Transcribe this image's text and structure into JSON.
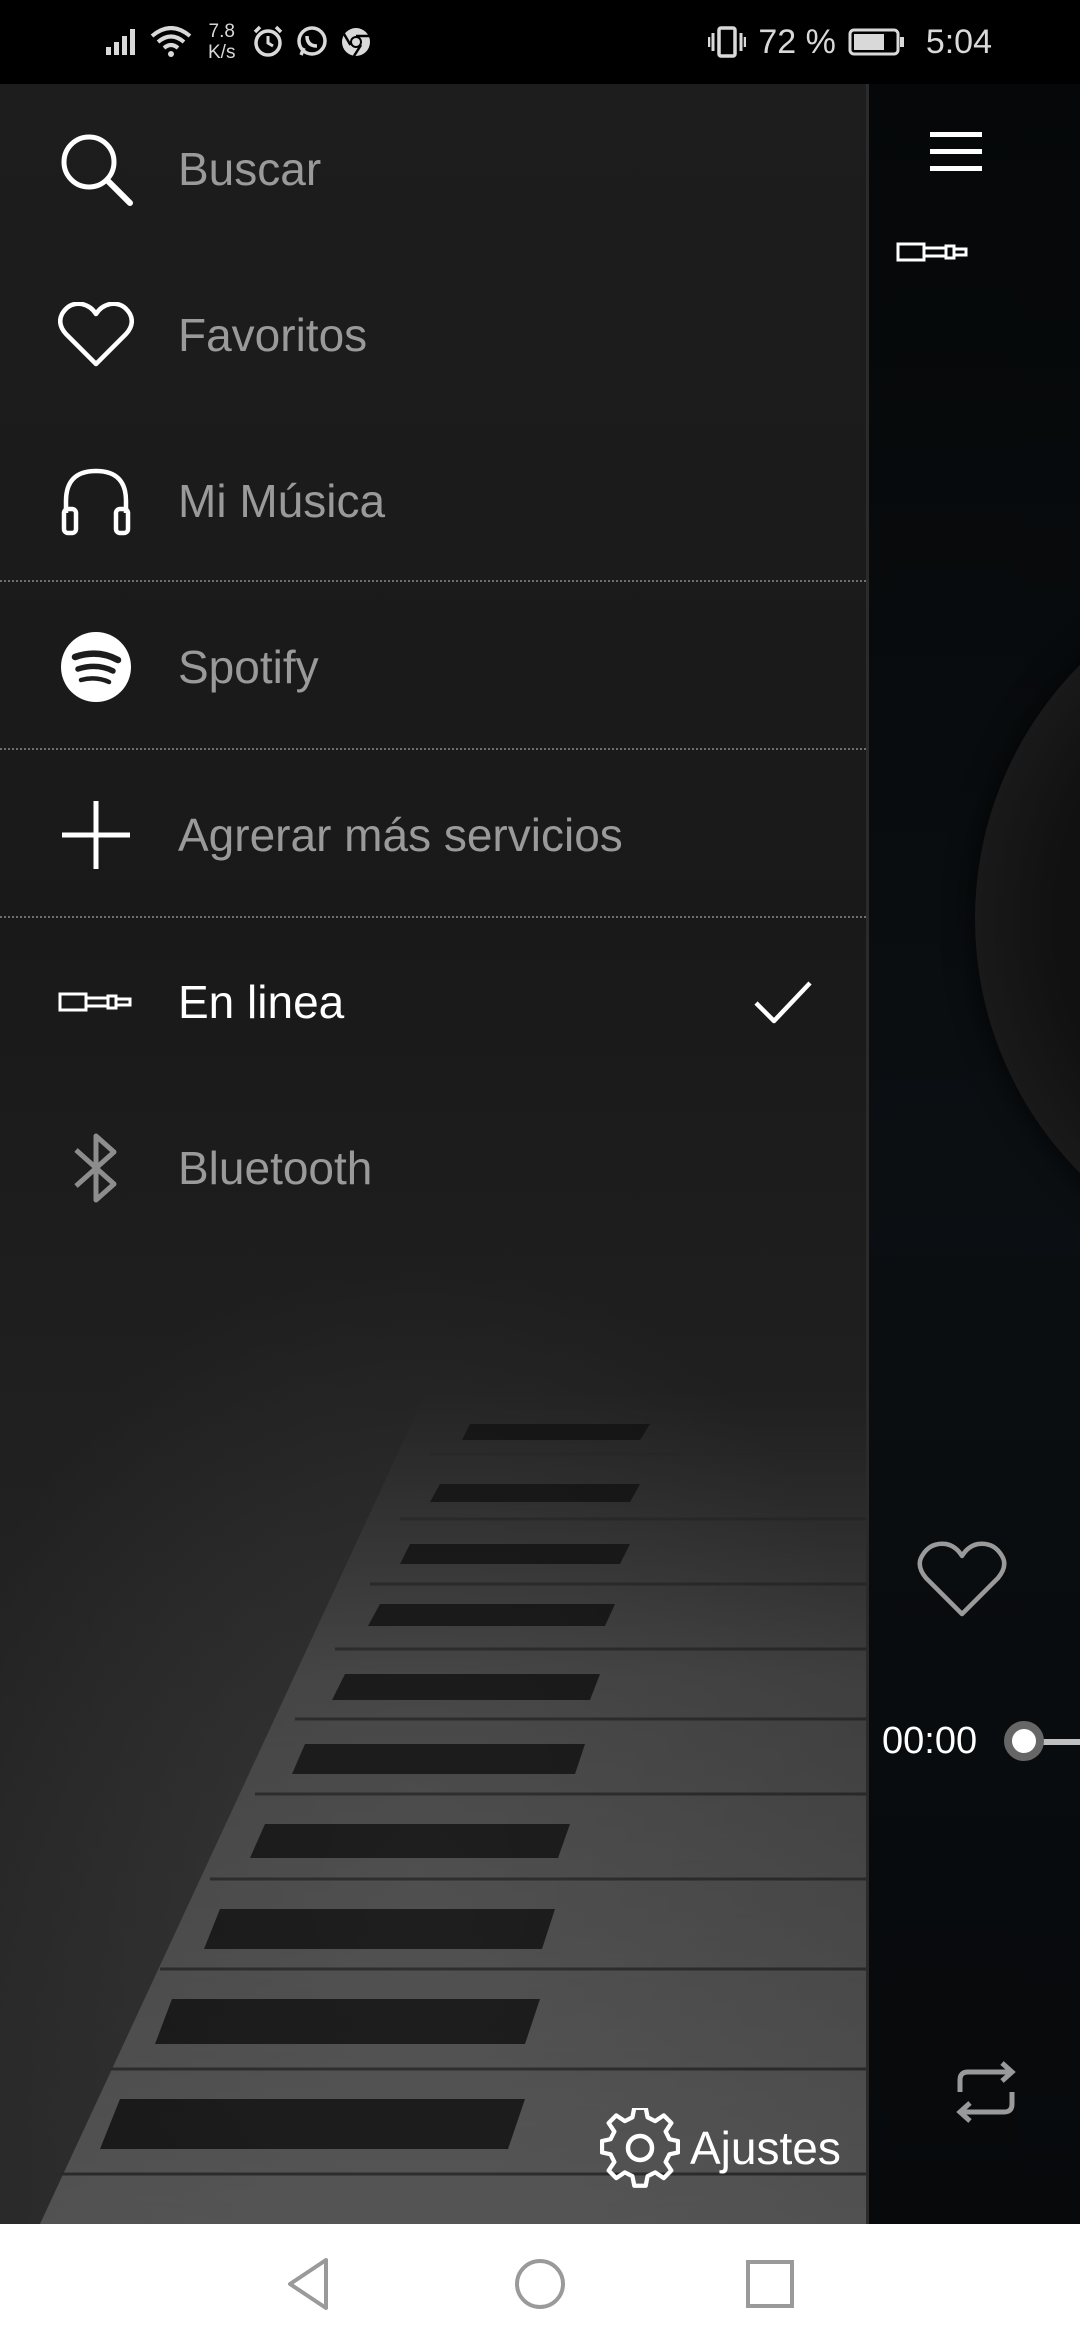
{
  "status_bar": {
    "net_speed_value": "7.8",
    "net_speed_unit": "K/s",
    "battery": "72 %",
    "time": "5:04"
  },
  "drawer": {
    "items": [
      {
        "label": "Buscar",
        "icon": "search-icon"
      },
      {
        "label": "Favoritos",
        "icon": "heart-icon"
      },
      {
        "label": "Mi Música",
        "icon": "headphones-icon"
      },
      {
        "label": "Spotify",
        "icon": "spotify-icon"
      },
      {
        "label": "Agrerar más servicios",
        "icon": "plus-icon"
      },
      {
        "label": "En linea",
        "icon": "audio-jack-icon",
        "selected": true
      },
      {
        "label": "Bluetooth",
        "icon": "bluetooth-icon"
      }
    ],
    "settings_label": "Ajustes"
  },
  "player": {
    "elapsed": "00:00"
  },
  "colors": {
    "drawer_bg": "#1d1d1d",
    "label_inactive": "#9a9a9a",
    "label_active": "#ffffff",
    "nav_bar_bg": "#ffffff"
  }
}
